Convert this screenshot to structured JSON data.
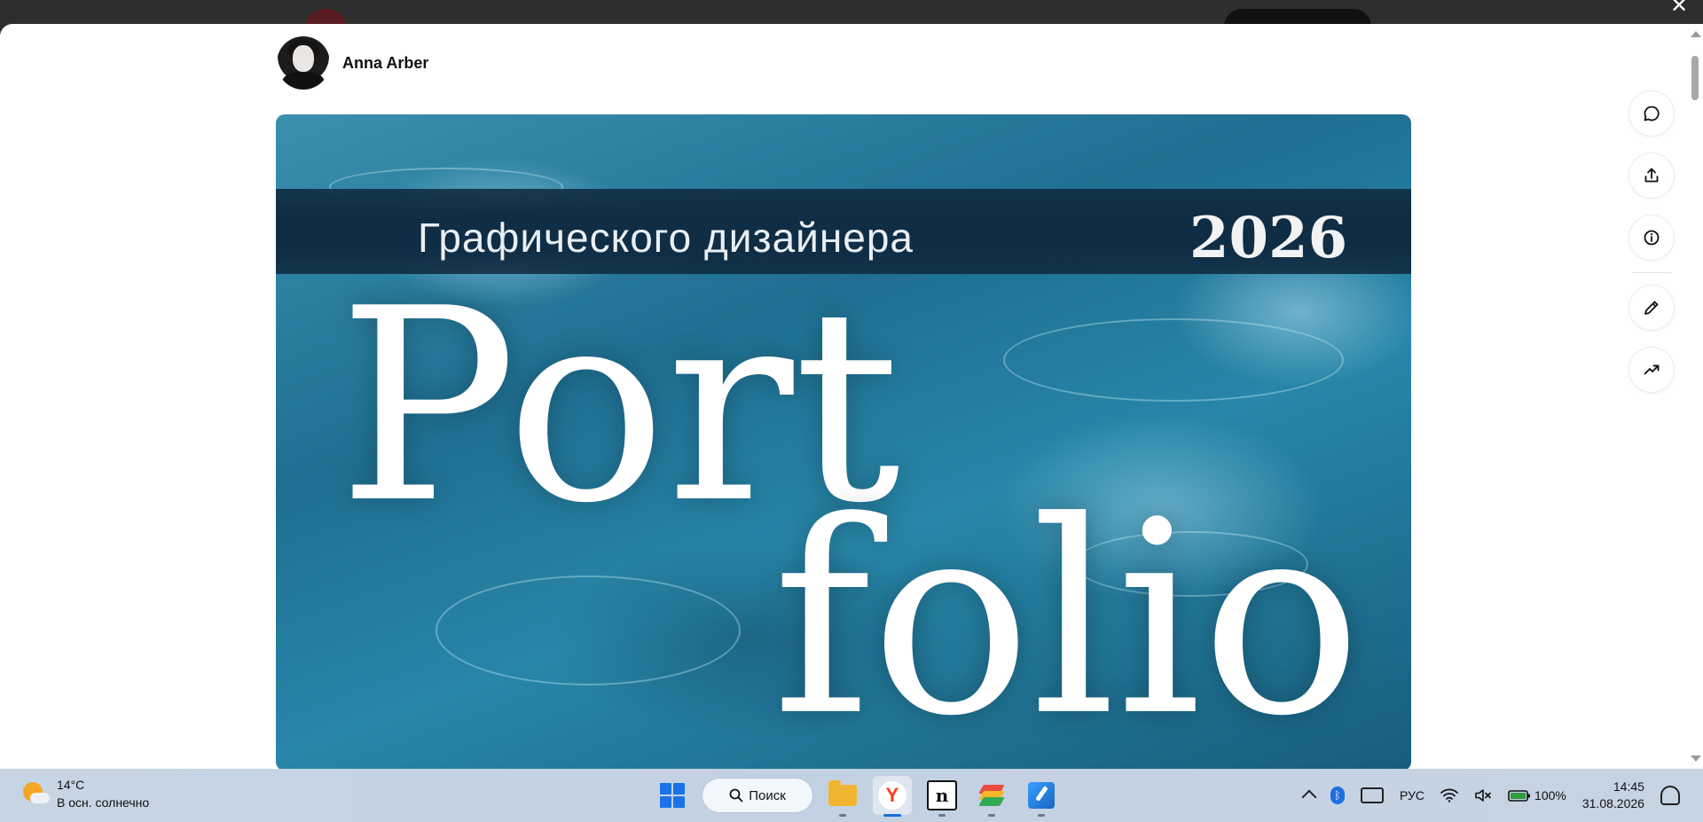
{
  "author": {
    "name": "Anna Arber"
  },
  "hero": {
    "band_left": "Графического дизайнера",
    "band_right": "2026",
    "word_1": "Port",
    "word_2": "folio"
  },
  "actions": {
    "comment": "comment-icon",
    "share": "share-icon",
    "info": "info-icon",
    "edit": "pencil-icon",
    "stats": "trending-up-icon"
  },
  "taskbar": {
    "weather_temp": "14°C",
    "weather_desc": "В осн. солнечно",
    "search_label": "Поиск",
    "lang": "РУС",
    "battery": "100%",
    "time": "14:45",
    "date": "31.08.2026"
  },
  "colors": {
    "band": "#0f2d45",
    "water": "#1f6f92",
    "accent_blue": "#1a73e8"
  }
}
